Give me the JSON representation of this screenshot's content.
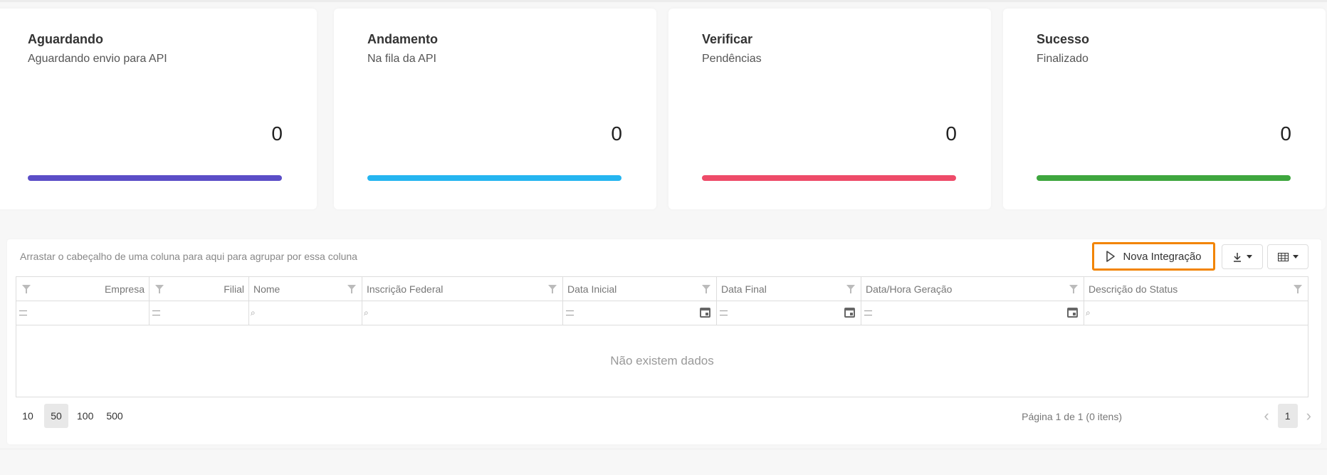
{
  "cards": [
    {
      "title": "Aguardando",
      "subtitle": "Aguardando envio para API",
      "count": "0",
      "color": "#5b4ec7"
    },
    {
      "title": "Andamento",
      "subtitle": "Na fila da API",
      "count": "0",
      "color": "#25b5f0"
    },
    {
      "title": "Verificar",
      "subtitle": "Pendências",
      "count": "0",
      "color": "#ee4b69"
    },
    {
      "title": "Sucesso",
      "subtitle": "Finalizado",
      "count": "0",
      "color": "#3ea63e"
    }
  ],
  "grid": {
    "group_hint": "Arrastar o cabeçalho de uma coluna para aqui para agrupar por essa coluna",
    "nova_integracao_label": "Nova Integração",
    "export_icon": "download-icon",
    "column_chooser_icon": "table-icon",
    "columns": [
      "Empresa",
      "Filial",
      "Nome",
      "Inscrição Federal",
      "Data Inicial",
      "Data Final",
      "Data/Hora Geração",
      "Descrição do Status"
    ],
    "no_data": "Não existem dados",
    "page_sizes": [
      "10",
      "50",
      "100",
      "500"
    ],
    "selected_page_size": "50",
    "page_info": "Página 1 de 1 (0 itens)",
    "current_page": "1"
  },
  "colors": {
    "accent_orange": "#f28400"
  }
}
